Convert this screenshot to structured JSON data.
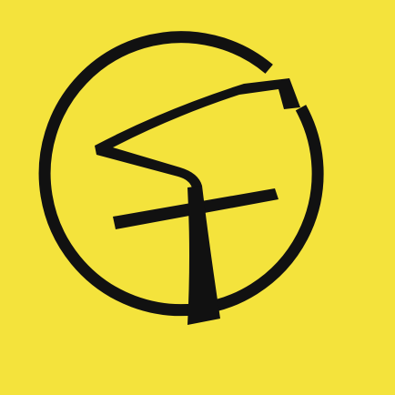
{
  "app_icon": {
    "icon": "sf-monogram-circle-logo",
    "colors": {
      "background": "#F4E33C",
      "mark": "#111111"
    }
  }
}
